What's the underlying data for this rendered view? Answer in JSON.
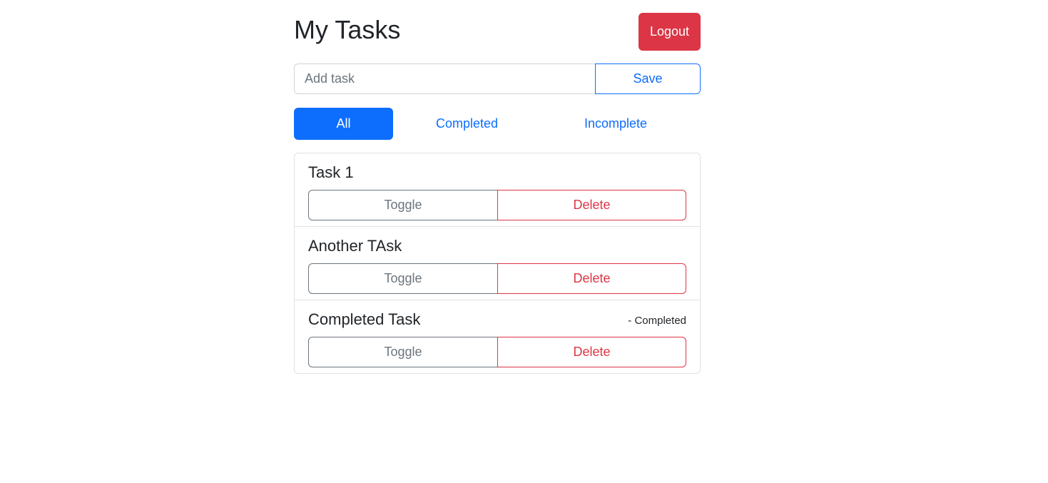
{
  "header": {
    "title": "My Tasks",
    "logout_label": "Logout"
  },
  "add_task": {
    "placeholder": "Add task",
    "value": "",
    "save_label": "Save"
  },
  "filters": [
    {
      "label": "All",
      "active": true
    },
    {
      "label": "Completed",
      "active": false
    },
    {
      "label": "Incomplete",
      "active": false
    }
  ],
  "tasks": [
    {
      "title": "Task 1",
      "status": "",
      "toggle_label": "Toggle",
      "delete_label": "Delete"
    },
    {
      "title": "Another TAsk",
      "status": "",
      "toggle_label": "Toggle",
      "delete_label": "Delete"
    },
    {
      "title": "Completed Task",
      "status": "- Completed",
      "toggle_label": "Toggle",
      "delete_label": "Delete"
    }
  ],
  "colors": {
    "primary": "#0d6efd",
    "danger": "#dc3545",
    "secondary": "#6c757d",
    "border": "#dee2e6"
  }
}
